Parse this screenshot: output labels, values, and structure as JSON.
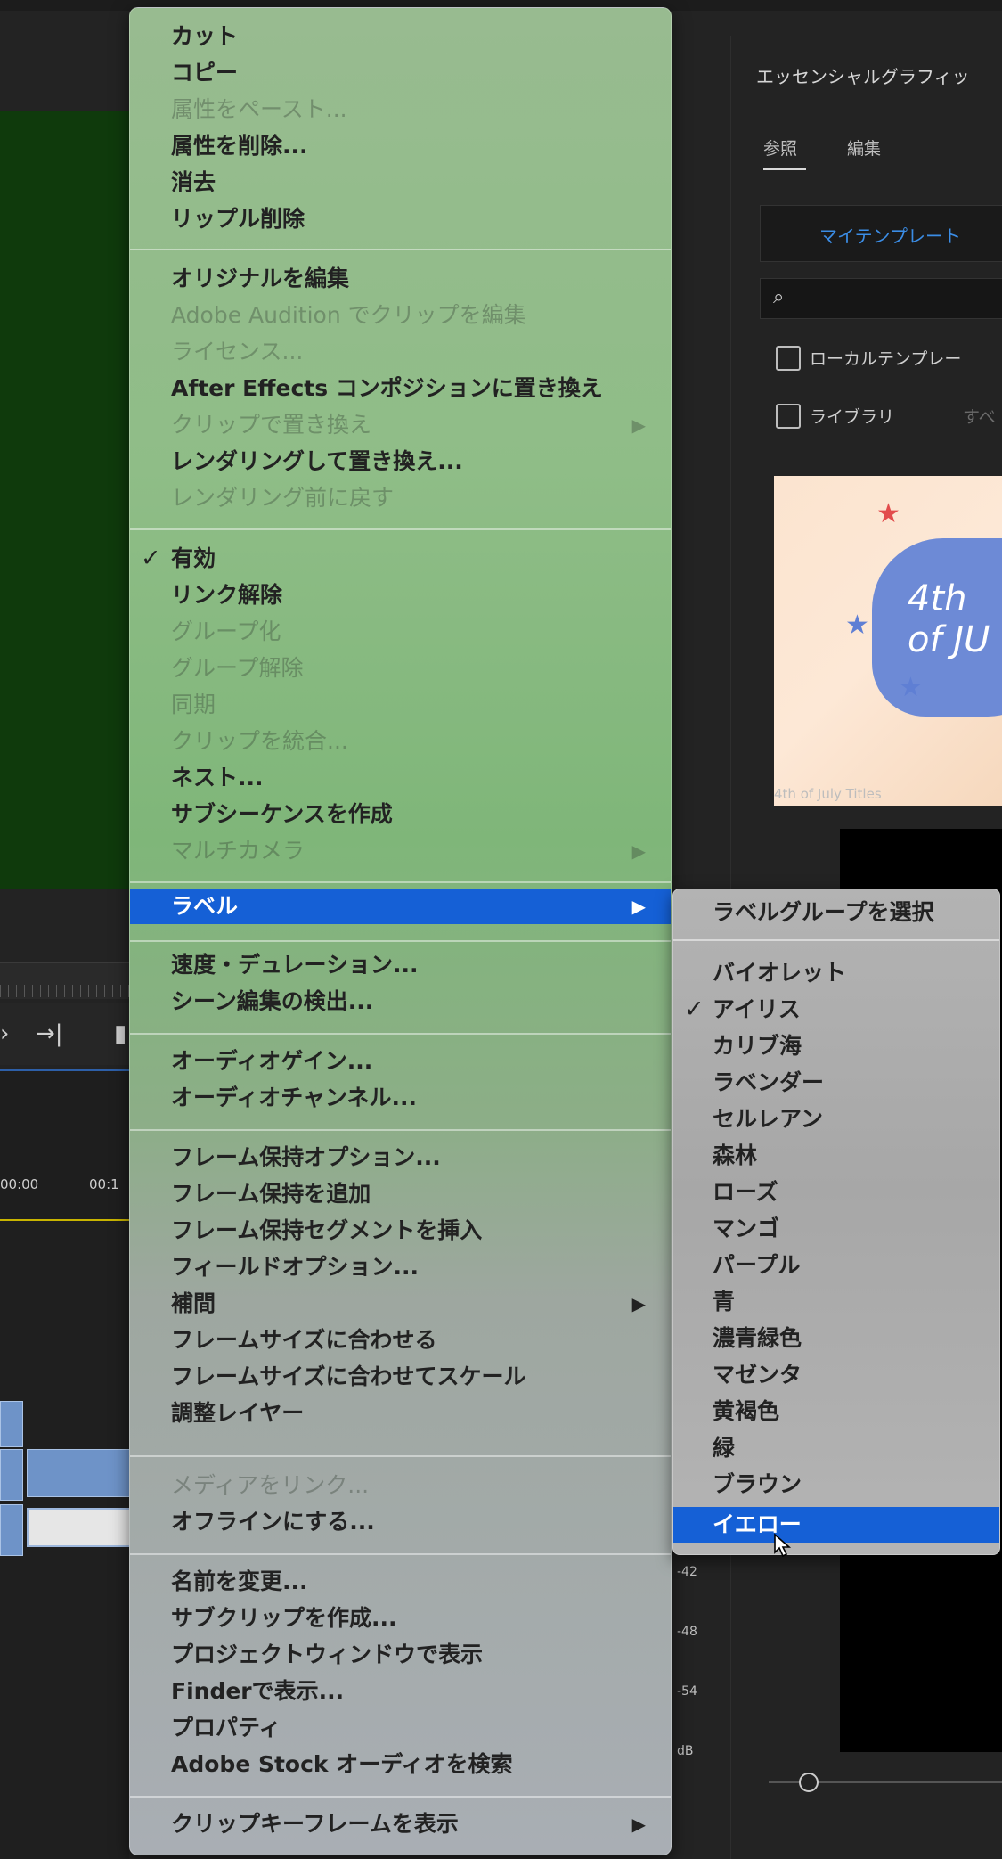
{
  "panel": {
    "title": "エッセンシャルグラフィッ",
    "tabs": [
      "参照",
      "編集"
    ],
    "template_button": "マイテンプレート",
    "search_icon": "search-icon",
    "checkbox_local": "ローカルテンプレー",
    "checkbox_library": "ライブラリ",
    "library_dropdown": "すべ",
    "thumbnail_text": "4th of JU",
    "thumbnail_caption": "4th of July Titles"
  },
  "timeline": {
    "timecodes": [
      "00:00",
      "00:1"
    ]
  },
  "meter": {
    "labels": [
      "-42",
      "-48",
      "-54",
      "dB"
    ]
  },
  "menu": {
    "items": [
      {
        "label": "カット"
      },
      {
        "label": "コピー"
      },
      {
        "label": "属性をペースト..."
      },
      {
        "label": "属性を削除..."
      },
      {
        "label": "消去"
      },
      {
        "label": "リップル削除"
      },
      {
        "label": "オリジナルを編集"
      },
      {
        "label": "Adobe Audition でクリップを編集"
      },
      {
        "label": "ライセンス..."
      },
      {
        "label": "After Effects コンポジションに置き換え"
      },
      {
        "label": "クリップで置き換え"
      },
      {
        "label": "レンダリングして置き換え..."
      },
      {
        "label": "レンダリング前に戻す"
      },
      {
        "label": "有効"
      },
      {
        "label": "リンク解除"
      },
      {
        "label": "グループ化"
      },
      {
        "label": "グループ解除"
      },
      {
        "label": "同期"
      },
      {
        "label": "クリップを統合..."
      },
      {
        "label": "ネスト..."
      },
      {
        "label": "サブシーケンスを作成"
      },
      {
        "label": "マルチカメラ"
      },
      {
        "label": "ラベル"
      },
      {
        "label": "速度・デュレーション..."
      },
      {
        "label": "シーン編集の検出..."
      },
      {
        "label": "オーディオゲイン..."
      },
      {
        "label": "オーディオチャンネル..."
      },
      {
        "label": "フレーム保持オプション..."
      },
      {
        "label": "フレーム保持を追加"
      },
      {
        "label": "フレーム保持セグメントを挿入"
      },
      {
        "label": "フィールドオプション..."
      },
      {
        "label": "補間"
      },
      {
        "label": "フレームサイズに合わせる"
      },
      {
        "label": "フレームサイズに合わせてスケール"
      },
      {
        "label": "調整レイヤー"
      },
      {
        "label": "メディアをリンク..."
      },
      {
        "label": "オフラインにする..."
      },
      {
        "label": "名前を変更..."
      },
      {
        "label": "サブクリップを作成..."
      },
      {
        "label": "プロジェクトウィンドウで表示"
      },
      {
        "label": "Finderで表示..."
      },
      {
        "label": "プロパティ"
      },
      {
        "label": "Adobe Stock オーディオを検索"
      },
      {
        "label": "クリップキーフレームを表示"
      }
    ],
    "check_glyph": "✓",
    "arrow_glyph": "▶"
  },
  "submenu": {
    "items": [
      {
        "label": "ラベルグループを選択"
      },
      {
        "label": "バイオレット"
      },
      {
        "label": "アイリス"
      },
      {
        "label": "カリブ海"
      },
      {
        "label": "ラベンダー"
      },
      {
        "label": "セルレアン"
      },
      {
        "label": "森林"
      },
      {
        "label": "ローズ"
      },
      {
        "label": "マンゴ"
      },
      {
        "label": "パープル"
      },
      {
        "label": "青"
      },
      {
        "label": "濃青緑色"
      },
      {
        "label": "マゼンタ"
      },
      {
        "label": "黄褐色"
      },
      {
        "label": "緑"
      },
      {
        "label": "ブラウン"
      },
      {
        "label": "イエロー"
      }
    ]
  },
  "colors": {
    "highlight": "#1560d6",
    "monitor_green": "#0f3a0c",
    "link_blue": "#3b8de6"
  }
}
